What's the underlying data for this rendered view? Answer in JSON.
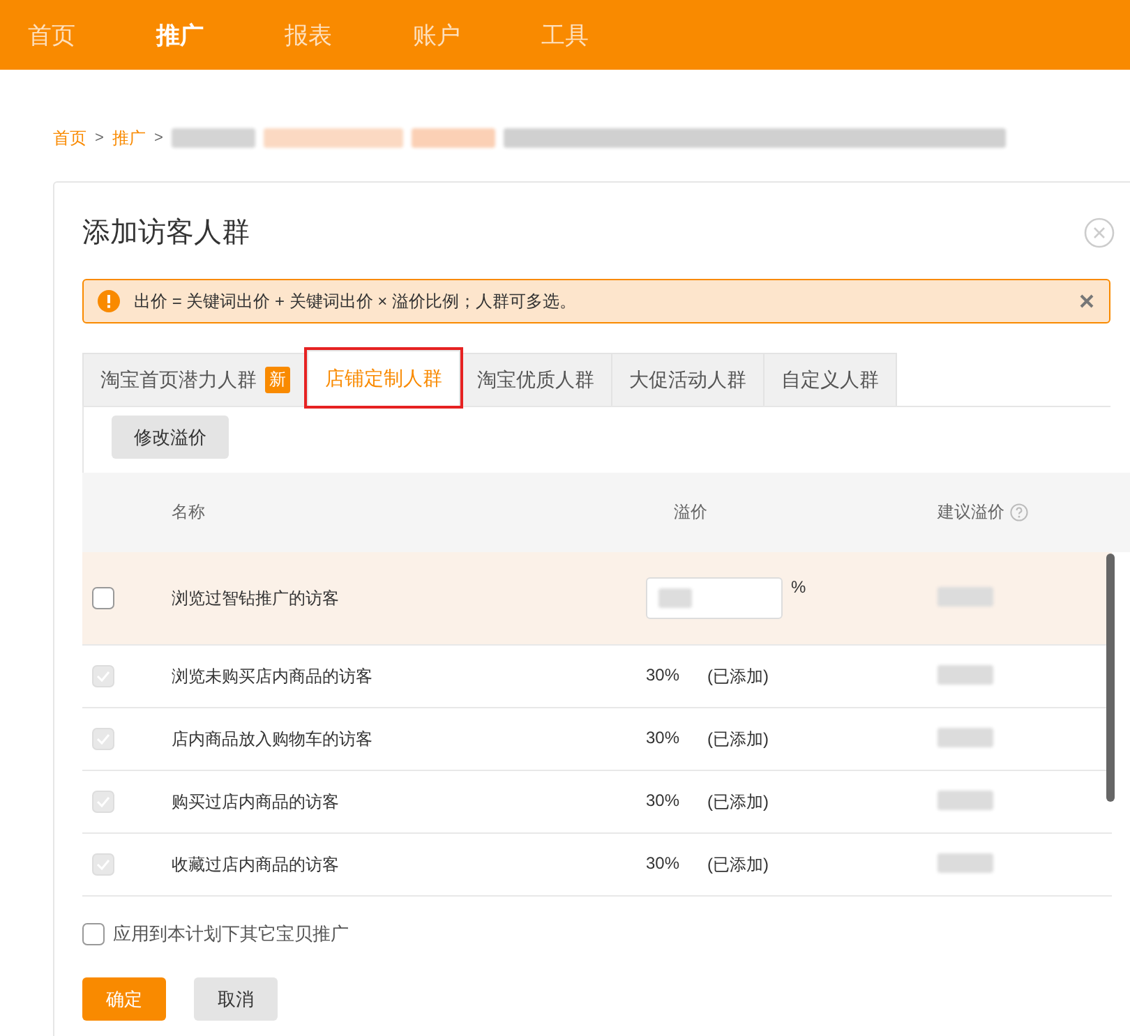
{
  "nav": [
    {
      "label": "首页",
      "selected": false
    },
    {
      "label": "推广",
      "selected": true
    },
    {
      "label": "报表",
      "selected": false
    },
    {
      "label": "账户",
      "selected": false
    },
    {
      "label": "工具",
      "selected": false
    }
  ],
  "breadcrumb": [
    {
      "label": "首页",
      "separator": ">"
    },
    {
      "label": "推广",
      "separator": ">"
    }
  ],
  "dialog": {
    "title": "添加访客人群",
    "alert": "出价 = 关键词出价 + 关键词出价 × 溢价比例；人群可多选。",
    "tabs": [
      {
        "label": "淘宝首页潜力人群",
        "badge": "新",
        "selected": false,
        "highlighted": false
      },
      {
        "label": "店铺定制人群",
        "selected": true,
        "highlighted": true
      },
      {
        "label": "淘宝优质人群",
        "selected": false,
        "highlighted": false
      },
      {
        "label": "大促活动人群",
        "selected": false,
        "highlighted": false
      },
      {
        "label": "自定义人群",
        "selected": false,
        "highlighted": false
      }
    ],
    "edit_button": "修改溢价",
    "table": {
      "columns": [
        "名称",
        "溢价",
        "建议溢价"
      ],
      "rows": [
        {
          "kind": "input",
          "name": "浏览过智钻推广的访客",
          "checked": false,
          "disabled": false,
          "highlighted": true,
          "unit": "%"
        },
        {
          "kind": "added",
          "name": "浏览未购买店内商品的访客",
          "checked": true,
          "disabled": true,
          "highlighted": false,
          "premium": "30%",
          "status": "(已添加)"
        },
        {
          "kind": "added",
          "name": "店内商品放入购物车的访客",
          "checked": true,
          "disabled": true,
          "highlighted": false,
          "premium": "30%",
          "status": "(已添加)"
        },
        {
          "kind": "added",
          "name": "购买过店内商品的访客",
          "checked": true,
          "disabled": true,
          "highlighted": false,
          "premium": "30%",
          "status": "(已添加)"
        },
        {
          "kind": "added",
          "name": "收藏过店内商品的访客",
          "checked": true,
          "disabled": true,
          "highlighted": false,
          "premium": "30%",
          "status": "(已添加)"
        }
      ]
    },
    "apply_all": {
      "label": "应用到本计划下其它宝贝推广",
      "checked": false
    },
    "buttons": [
      {
        "label": "确定",
        "kind": "primary"
      },
      {
        "label": "取消",
        "kind": "secondary"
      }
    ]
  }
}
